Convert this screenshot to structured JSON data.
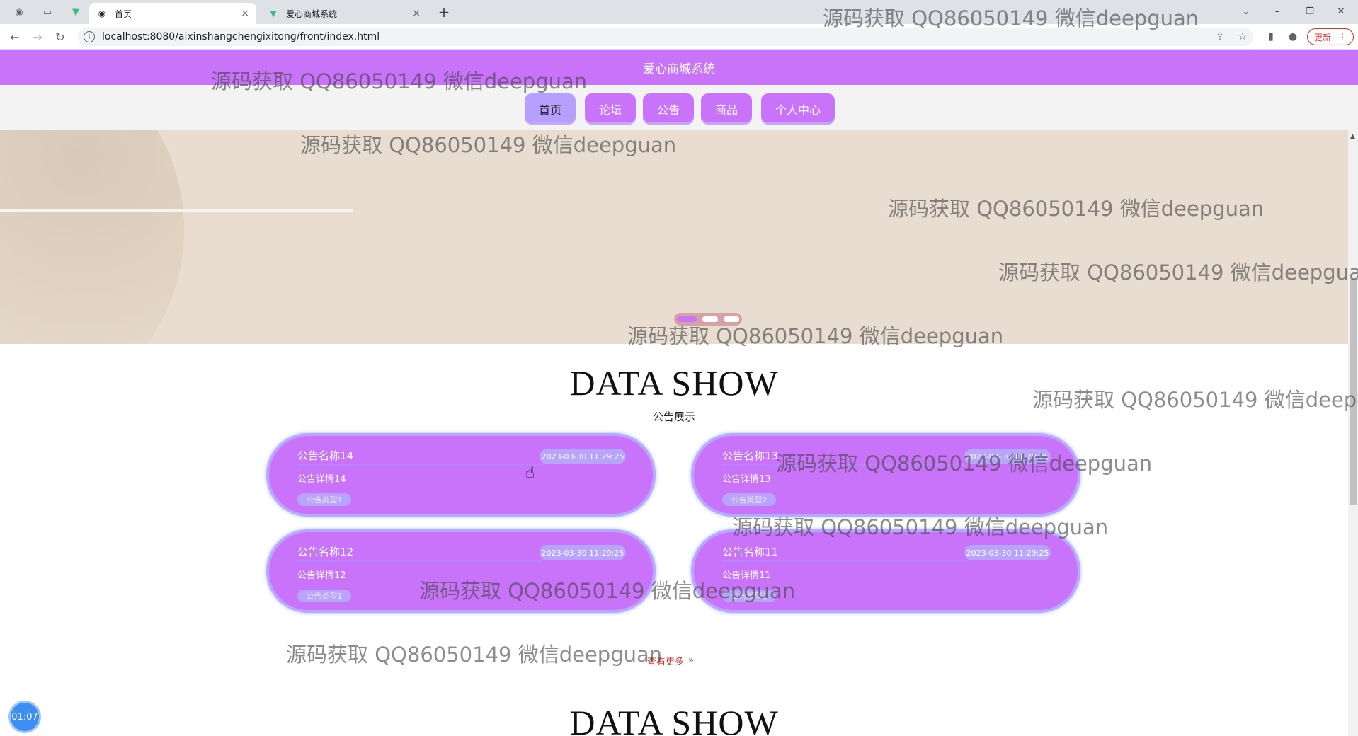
{
  "browser": {
    "tabs": [
      {
        "label": "首页",
        "icon": "globe-icon",
        "close": "×"
      },
      {
        "label": "爱心商城系统",
        "icon": "vue-icon",
        "close": "×"
      }
    ],
    "new_tab": "+",
    "window_controls": {
      "minimize": "–",
      "restore": "❐",
      "close": "✕",
      "tab_search": "⌄"
    },
    "url": "localhost:8080/aixinshangchengixitong/front/index.html",
    "update_label": "更新"
  },
  "site": {
    "title": "爱心商城系统",
    "nav": [
      {
        "label": "首页",
        "active": true
      },
      {
        "label": "论坛",
        "active": false
      },
      {
        "label": "公告",
        "active": false
      },
      {
        "label": "商品",
        "active": false
      },
      {
        "label": "个人中心",
        "active": false
      }
    ]
  },
  "banner": {
    "active_dot": 0,
    "dot_count": 3
  },
  "notice_section": {
    "title": "DATA SHOW",
    "subtitle": "公告展示",
    "cards": [
      {
        "name": "公告名称14",
        "date": "2023-03-30 11:29:25",
        "detail": "公告详情14",
        "type": "公告类型1"
      },
      {
        "name": "公告名称13",
        "date": "2023-03-30 11:29:25",
        "detail": "公告详情13",
        "type": "公告类型2"
      },
      {
        "name": "公告名称12",
        "date": "2023-03-30 11:29:25",
        "detail": "公告详情12",
        "type": "公告类型1"
      },
      {
        "name": "公告名称11",
        "date": "2023-03-30 11:29:25",
        "detail": "公告详情11",
        "type": "公告类型1"
      }
    ],
    "more_label": "查看更多",
    "more_icon": "»"
  },
  "next_section": {
    "title": "DATA SHOW"
  },
  "timer": "01:07",
  "watermark": "源码获取 QQ86050149 微信deepguan",
  "colors": {
    "primary": "#c873fa",
    "accent": "#b8a3ff",
    "banner": "#e8ddd0"
  }
}
